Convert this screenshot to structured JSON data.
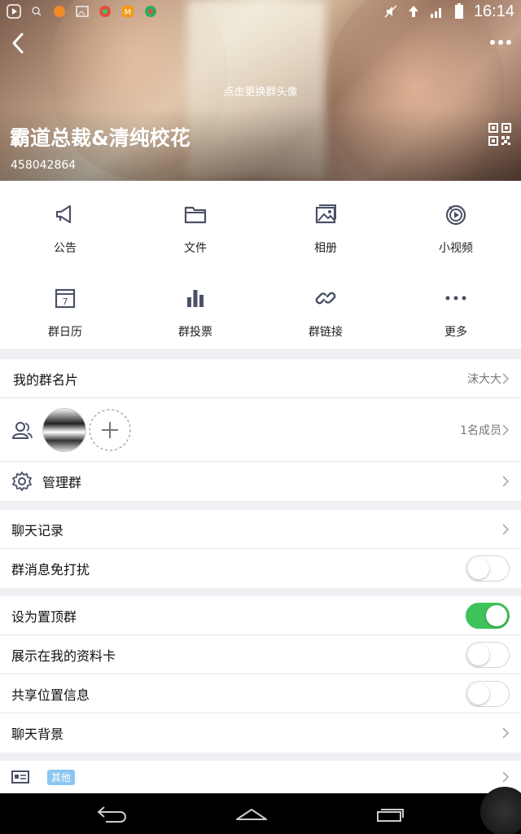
{
  "status_bar": {
    "time": "16:14"
  },
  "header": {
    "change_avatar_text": "点击更换群头像",
    "group_name": "霸道总裁&清纯校花",
    "group_id": "458042864"
  },
  "grid": [
    {
      "label": "公告",
      "icon": "megaphone-icon"
    },
    {
      "label": "文件",
      "icon": "folder-icon"
    },
    {
      "label": "相册",
      "icon": "album-icon"
    },
    {
      "label": "小视频",
      "icon": "video-icon"
    },
    {
      "label": "群日历",
      "icon": "calendar-icon"
    },
    {
      "label": "群投票",
      "icon": "vote-chart-icon"
    },
    {
      "label": "群链接",
      "icon": "link-icon"
    },
    {
      "label": "更多",
      "icon": "more-dots-icon"
    }
  ],
  "my_card": {
    "label": "我的群名片",
    "value": "沫大大"
  },
  "members": {
    "count_text": "1名成员"
  },
  "manage": {
    "label": "管理群"
  },
  "chat": {
    "history_label": "聊天记录",
    "mute_label": "群消息免打扰",
    "mute_on": false
  },
  "settings": {
    "pin_label": "设为置顶群",
    "pin_on": true,
    "show_profile_label": "展示在我的资料卡",
    "show_profile_on": false,
    "share_location_label": "共享位置信息",
    "share_location_on": false,
    "background_label": "聊天背景"
  },
  "other": {
    "tag": "其他"
  },
  "colors": {
    "toggle_on": "#3ec35b",
    "tag_bg": "#8cc6f0"
  }
}
